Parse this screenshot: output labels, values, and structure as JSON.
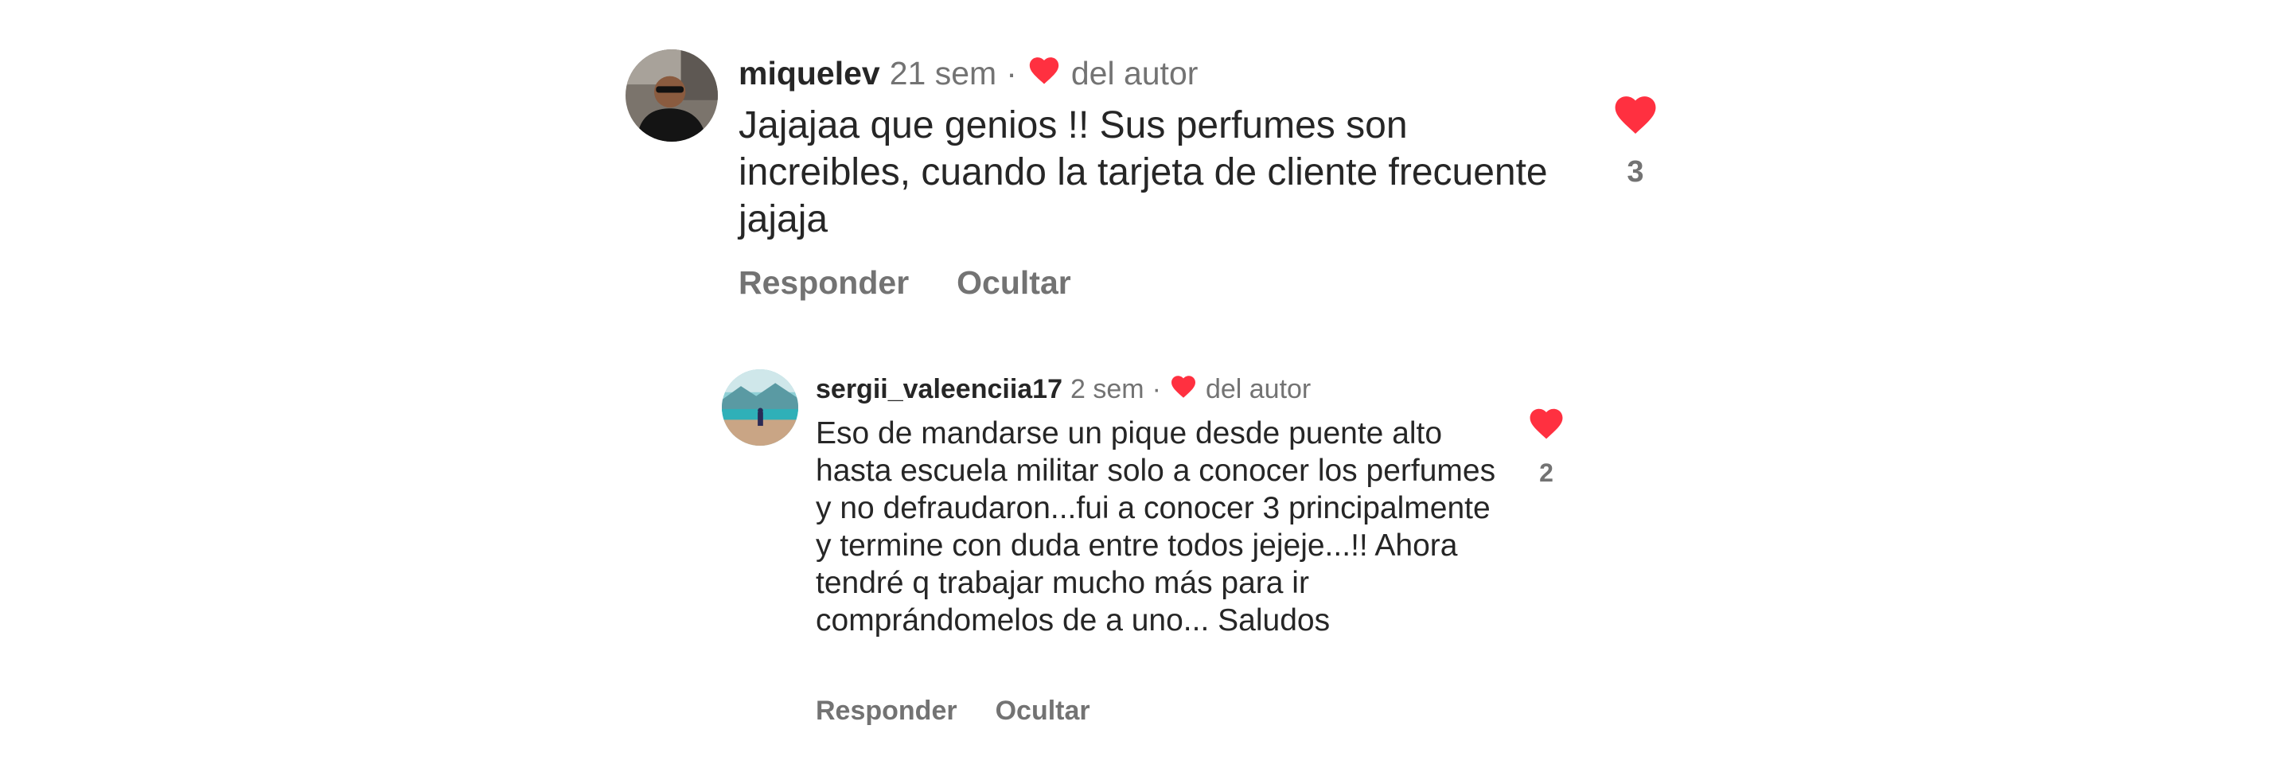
{
  "comments": [
    {
      "username": "miquelev",
      "time": "21 sem",
      "separator": "·",
      "author_like_label": "del autor",
      "text": "Jajajaa que genios !! Sus perfumes son increibles, cuando la tarjeta de cliente frecuente jajaja",
      "reply_label": "Responder",
      "hide_label": "Ocultar",
      "like_count": "3",
      "icons": {
        "like": "heart-icon",
        "author_like": "heart-icon"
      }
    },
    {
      "username": "sergii_valeenciia17",
      "time": "2 sem",
      "separator": "·",
      "author_like_label": "del autor",
      "text": "Eso de mandarse un pique desde puente alto hasta escuela militar solo a conocer los perfumes y no defraudaron...fui a conocer 3 principalmente y termine con duda entre todos jejeje...!! Ahora tendré q trabajar mucho más para ir comprándomelos de a uno... Saludos",
      "reply_label": "Responder",
      "hide_label": "Ocultar",
      "like_count": "2",
      "icons": {
        "like": "heart-icon",
        "author_like": "heart-icon"
      }
    }
  ],
  "colors": {
    "heart": "#ff3040",
    "text": "#262626",
    "muted": "#737373"
  }
}
